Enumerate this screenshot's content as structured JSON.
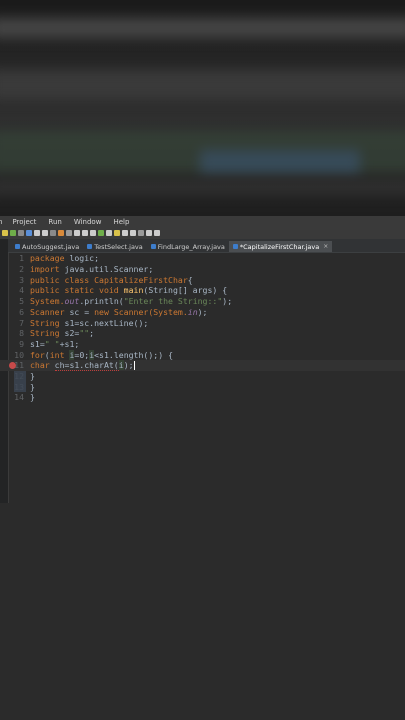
{
  "menu": [
    "n",
    "Project",
    "Run",
    "Window",
    "Help"
  ],
  "tabs": [
    {
      "label": "AutoSuggest.java",
      "active": false
    },
    {
      "label": "TestSelect.java",
      "active": false
    },
    {
      "label": "FindLarge_Array.java",
      "active": false
    },
    {
      "label": "*CapitalizeFirstChar.java",
      "active": true,
      "close": "×"
    }
  ],
  "editor": {
    "line_numbers": [
      "1",
      "2",
      "3",
      "4",
      "5",
      "6",
      "7",
      "8",
      "9",
      "10",
      "11",
      "12",
      "13",
      "14"
    ],
    "lines": [
      [
        {
          "t": "package ",
          "c": "kw"
        },
        {
          "t": "logic;",
          "c": "cls"
        }
      ],
      [
        {
          "t": "import ",
          "c": "kw"
        },
        {
          "t": "java.util.Scanner;",
          "c": "cls"
        }
      ],
      [
        {
          "t": "public class ",
          "c": "kw"
        },
        {
          "t": "CapitalizeFirstChar",
          "c": "kw"
        },
        {
          "t": "{",
          "c": "cls"
        }
      ],
      [
        {
          "t": "public static void ",
          "c": "kw"
        },
        {
          "t": "main",
          "c": "mth"
        },
        {
          "t": "(String[] args) {",
          "c": "cls"
        }
      ],
      [
        {
          "t": "System.",
          "c": "kw"
        },
        {
          "t": "out",
          "c": "fld"
        },
        {
          "t": ".println(",
          "c": "cls"
        },
        {
          "t": "\"Enter the String::\"",
          "c": "str"
        },
        {
          "t": ");",
          "c": "cls"
        }
      ],
      [
        {
          "t": "Scanner ",
          "c": "kw"
        },
        {
          "t": "sc = ",
          "c": "cls"
        },
        {
          "t": "new ",
          "c": "kw"
        },
        {
          "t": "Scanner(",
          "c": "kw"
        },
        {
          "t": "System.",
          "c": "kw"
        },
        {
          "t": "in",
          "c": "fld"
        },
        {
          "t": ");",
          "c": "cls"
        }
      ],
      [
        {
          "t": "String ",
          "c": "kw"
        },
        {
          "t": "s1=sc.nextLine();",
          "c": "cls"
        }
      ],
      [
        {
          "t": "String ",
          "c": "kw"
        },
        {
          "t": "s2=",
          "c": "cls"
        },
        {
          "t": "\"\"",
          "c": "str"
        },
        {
          "t": ";",
          "c": "cls"
        }
      ],
      [
        {
          "t": "s1=",
          "c": "cls"
        },
        {
          "t": "\" \"",
          "c": "str"
        },
        {
          "t": "+s1;",
          "c": "cls"
        }
      ],
      [
        {
          "t": "for",
          "c": "kw"
        },
        {
          "t": "(",
          "c": "cls"
        },
        {
          "t": "int ",
          "c": "kw"
        },
        {
          "t": "i",
          "c": "hl"
        },
        {
          "t": "=0;",
          "c": "cls"
        },
        {
          "t": "i",
          "c": "hl"
        },
        {
          "t": "<s1.length();) {",
          "c": "cls"
        }
      ],
      [
        {
          "t": "char ",
          "c": "kw"
        },
        {
          "t": "ch=s1.charAt(",
          "c": "cls"
        },
        {
          "t": "i",
          "c": "hl"
        },
        {
          "t": ");",
          "c": "cls"
        }
      ],
      [
        {
          "t": "}",
          "c": "cls"
        }
      ],
      [
        {
          "t": "}",
          "c": "cls"
        }
      ],
      [
        {
          "t": "}",
          "c": "cls"
        }
      ]
    ]
  },
  "toolbar_colors": [
    "#d9c24a",
    "#6fae4a",
    "#8a8a8a",
    "#5a8fd8",
    "#cccccc",
    "#cccccc",
    "#8a8a8a",
    "#d98a3a",
    "#9a9a9a",
    "#cccccc",
    "#cccccc",
    "#cccccc",
    "#6fae4a",
    "#c9c9c9",
    "#d9c24a",
    "#cccccc",
    "#cccccc",
    "#9a9a9a",
    "#cccccc",
    "#cccccc"
  ]
}
